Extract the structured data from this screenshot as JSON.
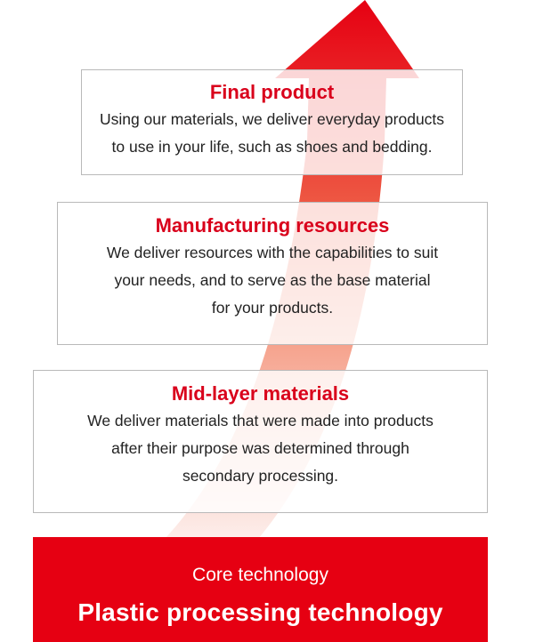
{
  "core": {
    "subtitle": "Core technology",
    "title": "Plastic processing technology"
  },
  "levels": [
    {
      "title": "Final product",
      "lines": [
        "Using our materials, we deliver everyday products",
        "to use in your life, such as shoes and bedding."
      ]
    },
    {
      "title": "Manufacturing resources",
      "lines": [
        "We deliver resources with the capabilities to suit",
        "your needs, and to serve as the base material",
        "for your products."
      ]
    },
    {
      "title": "Mid-layer materials",
      "lines": [
        "We deliver materials that were made into products",
        "after their purpose was determined through",
        "secondary processing."
      ]
    }
  ],
  "colors": {
    "accent": "#e60012",
    "title_red": "#d9001b",
    "arrow_top": "#e60012",
    "arrow_bottom": "#fbe0dc",
    "box_border": "#b9b9b9"
  }
}
